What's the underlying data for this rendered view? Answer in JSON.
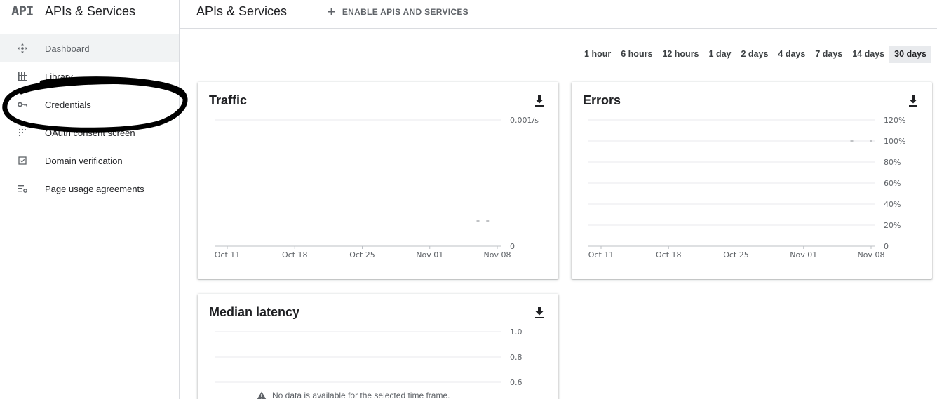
{
  "brand": {
    "logo": "API",
    "title": "APIs & Services"
  },
  "sidebar": {
    "items": [
      {
        "label": "Dashboard",
        "icon": "dashboard-icon",
        "active": true
      },
      {
        "label": "Library",
        "icon": "library-icon"
      },
      {
        "label": "Credentials",
        "icon": "key-icon"
      },
      {
        "label": "OAuth consent screen",
        "icon": "consent-icon"
      },
      {
        "label": "Domain verification",
        "icon": "checkbox-icon"
      },
      {
        "label": "Page usage agreements",
        "icon": "settings-list-icon"
      }
    ]
  },
  "header": {
    "title": "APIs & Services",
    "enable_label": "ENABLE APIS AND SERVICES"
  },
  "time_range": {
    "options": [
      "1 hour",
      "6 hours",
      "12 hours",
      "1 day",
      "2 days",
      "4 days",
      "7 days",
      "14 days",
      "30 days"
    ],
    "selected": "30 days"
  },
  "cards": {
    "traffic": {
      "title": "Traffic"
    },
    "errors": {
      "title": "Errors"
    },
    "latency": {
      "title": "Median latency",
      "nodata": "No data is available for the selected time frame."
    }
  },
  "chart_data": [
    {
      "type": "line",
      "title": "Traffic",
      "x_ticks": [
        "Oct 11",
        "Oct 18",
        "Oct 25",
        "Nov 01",
        "Nov 08"
      ],
      "y_ticks": [
        "0.001/s",
        "0"
      ],
      "ylim": [
        0,
        0.001
      ],
      "series": [
        {
          "x": [
            "Nov 06",
            "Nov 07"
          ],
          "values": [
            0.0002,
            0.0002
          ]
        }
      ]
    },
    {
      "type": "line",
      "title": "Errors",
      "x_ticks": [
        "Oct 11",
        "Oct 18",
        "Oct 25",
        "Nov 01",
        "Nov 08"
      ],
      "y_ticks": [
        "120%",
        "100%",
        "80%",
        "60%",
        "40%",
        "20%",
        "0"
      ],
      "ylim": [
        0,
        120
      ],
      "series": [
        {
          "x": [
            "Nov 06",
            "Nov 08"
          ],
          "values": [
            100,
            100
          ]
        }
      ]
    },
    {
      "type": "line",
      "title": "Median latency",
      "y_ticks": [
        "1.0",
        "0.8",
        "0.6"
      ],
      "series": []
    }
  ]
}
